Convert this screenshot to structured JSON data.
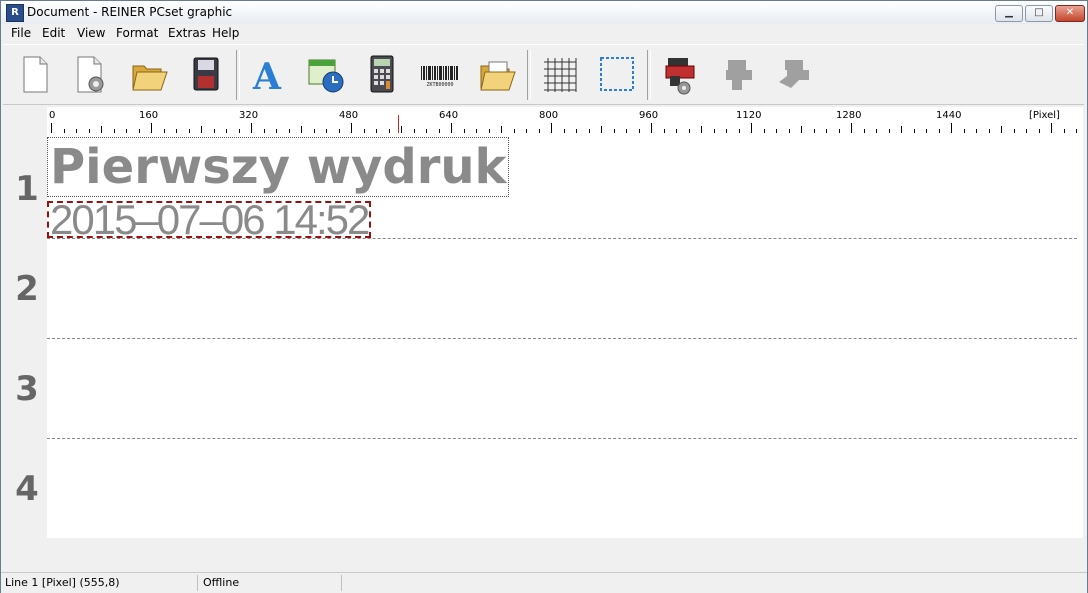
{
  "window": {
    "title": "Document - REINER PCset graphic",
    "app_icon_glyph": "R",
    "minimize_glyph": "▁",
    "maximize_glyph": "□",
    "close_glyph": "✕"
  },
  "menu": {
    "items": [
      "File",
      "Edit",
      "View",
      "Format",
      "Extras",
      "Help"
    ]
  },
  "toolbar": {
    "buttons": [
      {
        "icon": "new-document-icon"
      },
      {
        "icon": "document-settings-icon"
      },
      {
        "icon": "open-folder-icon"
      },
      {
        "icon": "save-disk-icon"
      },
      {
        "icon": "text-tool-icon",
        "glyph": "A"
      },
      {
        "icon": "date-time-icon"
      },
      {
        "icon": "calculator-icon"
      },
      {
        "icon": "barcode-icon"
      },
      {
        "icon": "import-image-folder-icon"
      },
      {
        "icon": "grid-icon"
      },
      {
        "icon": "selection-frame-icon"
      },
      {
        "icon": "printer-settings-icon"
      },
      {
        "icon": "printer-disabled-icon"
      },
      {
        "icon": "printer-send-disabled-icon"
      }
    ],
    "barcode_text": "ZKTB00000"
  },
  "ruler": {
    "labels": [
      "0",
      "160",
      "320",
      "480",
      "640",
      "800",
      "960",
      "1120",
      "1280",
      "1440"
    ],
    "unit": "[Pixel]",
    "cursor_value": 555
  },
  "document": {
    "line_numbers": [
      "1",
      "2",
      "3",
      "4"
    ],
    "text_title": "Pierwszy wydruk",
    "text_date": "2015–07–06 14:52"
  },
  "status": {
    "position": "Line 1 [Pixel] (555,8)",
    "connection": "Offline",
    "extra": ""
  },
  "colors": {
    "cursor_marker": "#cc2222",
    "selection_border": "#9a1010",
    "text_gray": "#8a8a8a",
    "line_number_gray": "#666666"
  }
}
